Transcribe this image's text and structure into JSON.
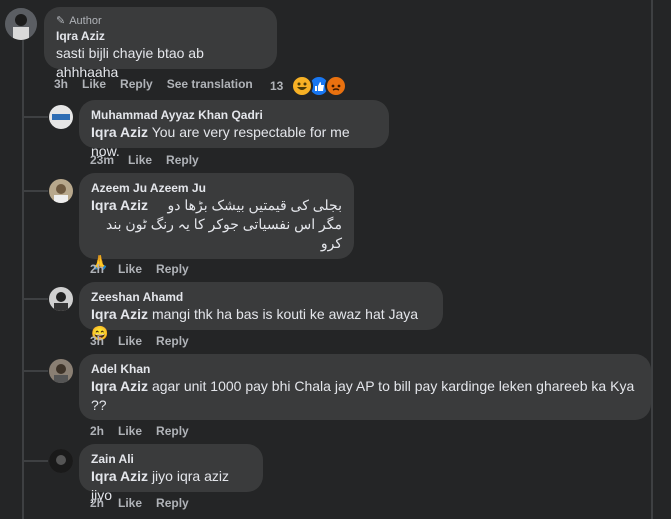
{
  "main_comment": {
    "author_badge": "Author",
    "name": "Iqra Aziz",
    "text": "sasti bijli chayie btao ab ahhhaaha",
    "time": "3h",
    "like": "Like",
    "reply": "Reply",
    "see_translation": "See translation",
    "reaction_count": "13",
    "reactions": [
      "haha-icon",
      "like-icon",
      "angry-icon"
    ]
  },
  "replies": [
    {
      "name": "Muhammad Ayyaz Khan Qadri",
      "tag": "Iqra Aziz",
      "text": "You are very respectable for me now.",
      "time": "23m",
      "like": "Like",
      "reply": "Reply"
    },
    {
      "name": "Azeem Ju Azeem Ju",
      "tag": "Iqra Aziz",
      "text_line1": "بجلی کی قیمتیں بیشک بڑھا دو",
      "text_line2": "مگر اس نفسیاتی جوکر کا یہ رنگ ٹون بند کرو",
      "emoji": "🙏",
      "time": "2h",
      "like": "Like",
      "reply": "Reply"
    },
    {
      "name": "Zeeshan Ahamd",
      "tag": "Iqra Aziz",
      "text": "mangi thk ha bas is kouti ke awaz hat Jaya 😄",
      "time": "3h",
      "like": "Like",
      "reply": "Reply"
    },
    {
      "name": "Adel Khan",
      "tag": "Iqra Aziz",
      "text": "agar unit 1000 pay bhi Chala jay AP to bill pay kardinge leken ghareeb ka Kya ??",
      "time": "2h",
      "like": "Like",
      "reply": "Reply"
    },
    {
      "name": "Zain Ali",
      "tag": "Iqra Aziz",
      "text": "jiyo iqra aziz jiyo",
      "time": "2h",
      "like": "Like",
      "reply": "Reply"
    }
  ],
  "colors": {
    "background": "#242526",
    "bubble": "#3a3b3c",
    "text": "#e4e6eb",
    "secondary": "#b0b3b8",
    "like_blue": "#1877f2",
    "haha_yellow": "#f7b125",
    "angry_red": "#e9710f"
  }
}
